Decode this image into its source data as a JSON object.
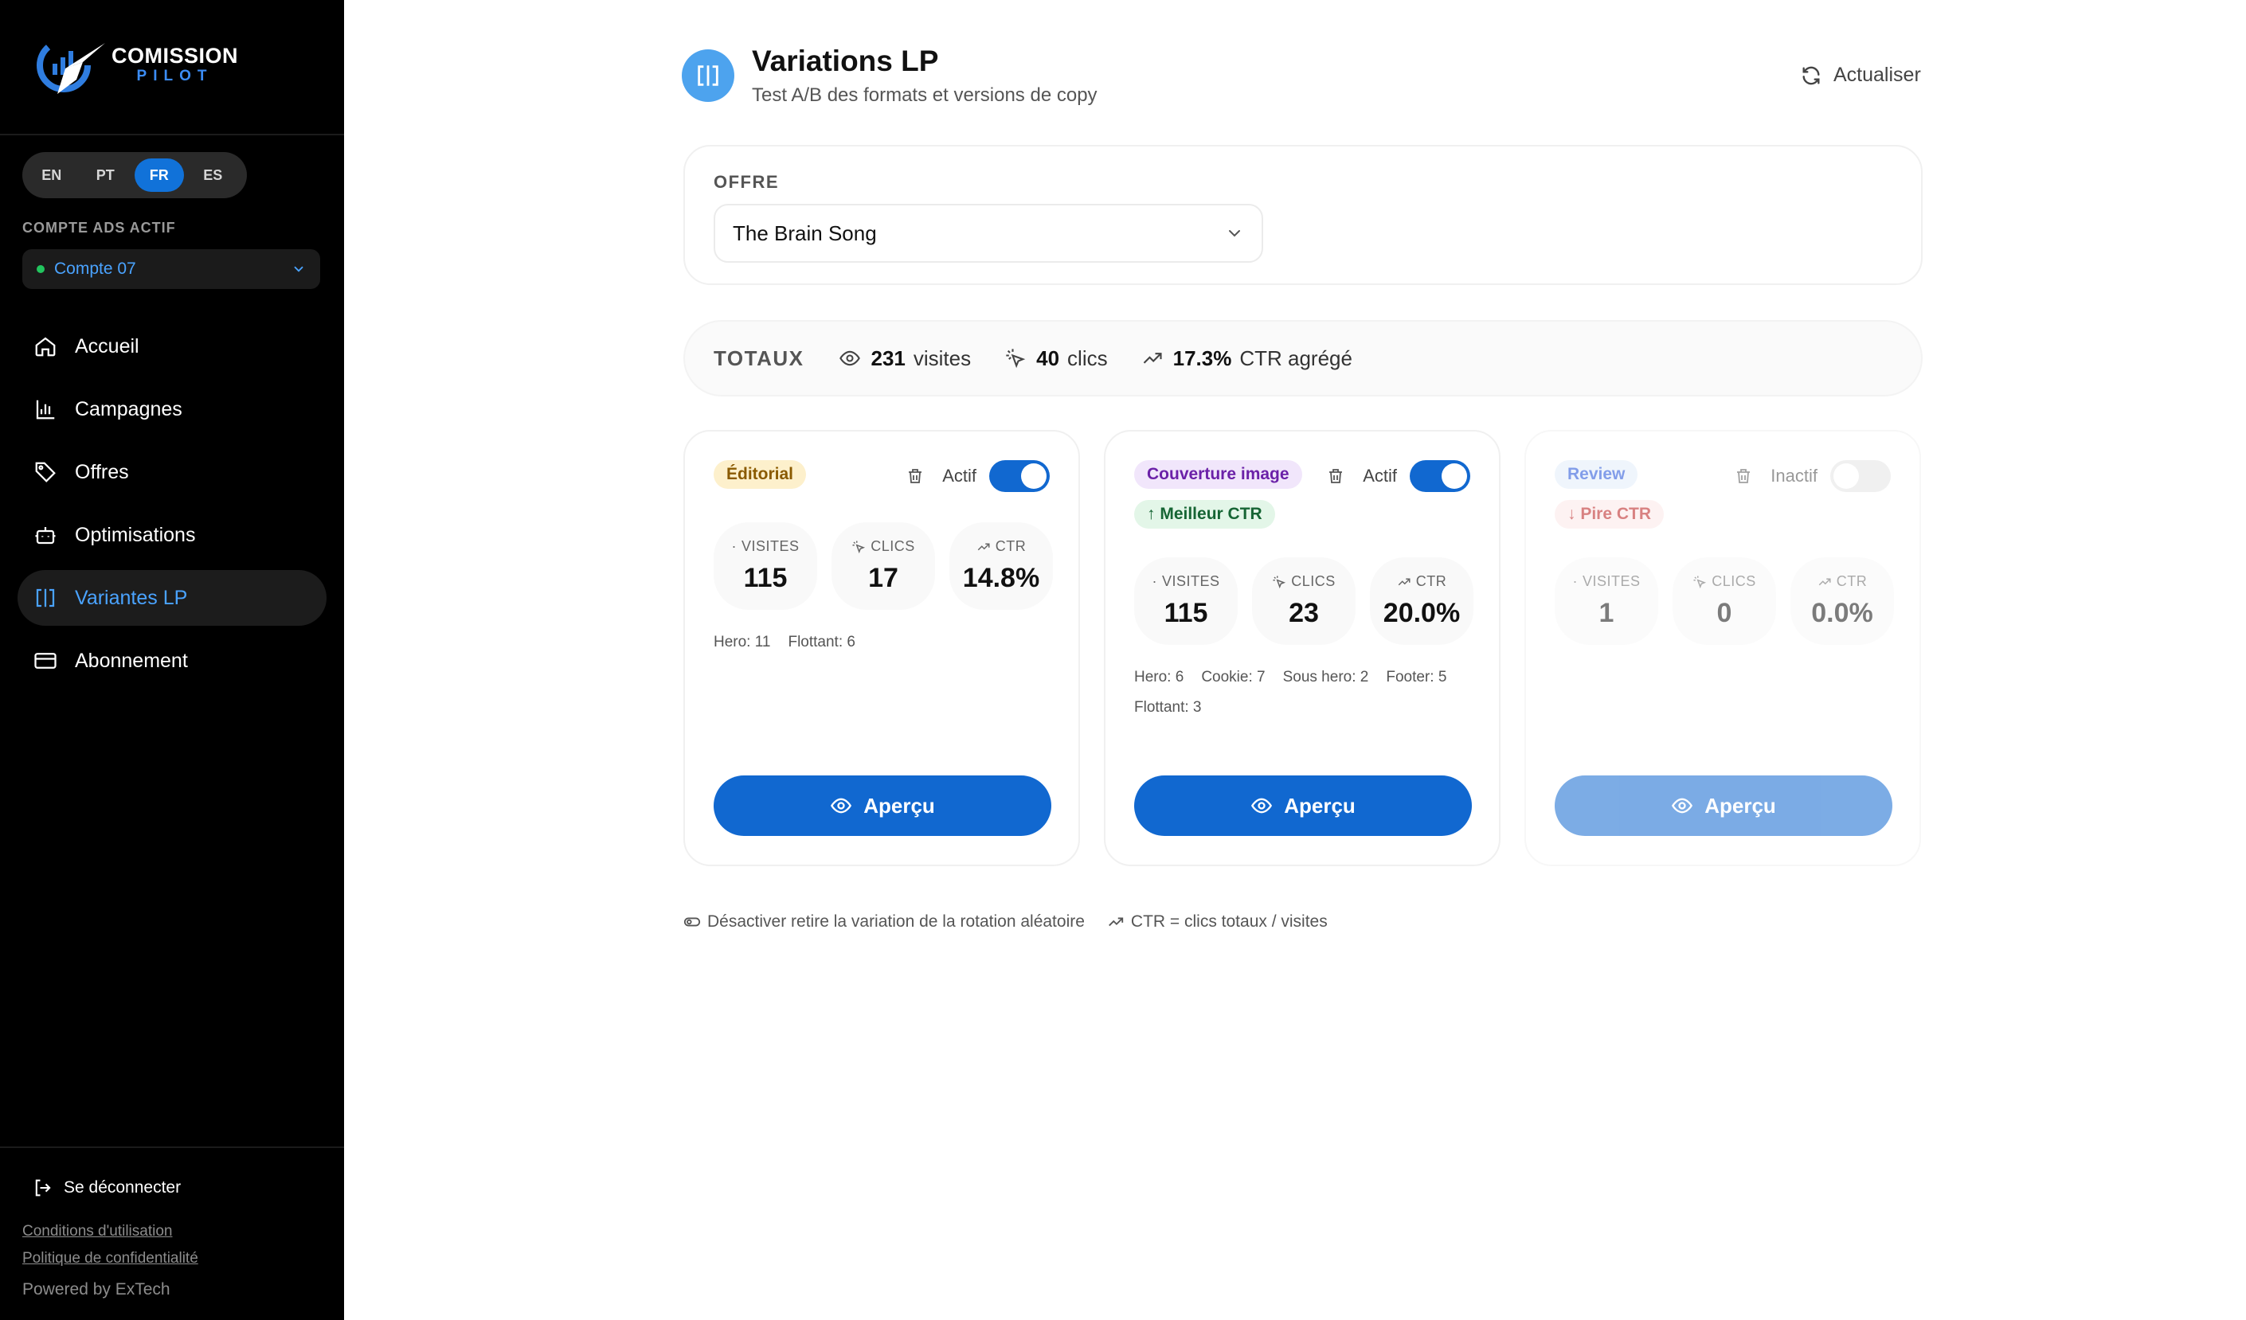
{
  "brand": {
    "line1": "COMISSION",
    "line2": "PILOT",
    "accent": "#3b8cf5"
  },
  "languages": [
    {
      "code": "EN",
      "active": false
    },
    {
      "code": "PT",
      "active": false
    },
    {
      "code": "FR",
      "active": true
    },
    {
      "code": "ES",
      "active": false
    }
  ],
  "account": {
    "section_label": "COMPTE ADS ACTIF",
    "name": "Compte 07",
    "status_color": "#22c55e"
  },
  "nav": [
    {
      "label": "Accueil",
      "icon": "home-icon"
    },
    {
      "label": "Campagnes",
      "icon": "bar-chart-icon"
    },
    {
      "label": "Offres",
      "icon": "tag-icon"
    },
    {
      "label": "Optimisations",
      "icon": "robot-icon"
    },
    {
      "label": "Variantes LP",
      "icon": "split-icon",
      "active": true
    },
    {
      "label": "Abonnement",
      "icon": "credit-card-icon"
    }
  ],
  "sidebar_footer": {
    "logout": "Se déconnecter",
    "terms": "Conditions d'utilisation",
    "privacy": "Politique de confidentialité",
    "powered": "Powered by ExTech"
  },
  "header": {
    "title": "Variations LP",
    "subtitle": "Test A/B des formats et versions de copy",
    "refresh": "Actualiser"
  },
  "offer": {
    "label": "OFFRE",
    "selected": "The Brain Song"
  },
  "totals": {
    "label": "TOTAUX",
    "visits": "231",
    "visits_label": "visites",
    "clicks": "40",
    "clicks_label": "clics",
    "ctr": "17.3%",
    "ctr_label": "CTR agrégé"
  },
  "stat_labels": {
    "visits": "VISITES",
    "clicks": "CLICS",
    "ctr": "CTR"
  },
  "variants": [
    {
      "name": "Éditorial",
      "badge_bg": "#fdf0cc",
      "badge_color": "#8a5a00",
      "status": "Actif",
      "active": true,
      "tag": null,
      "visits": "115",
      "clicks": "17",
      "ctr": "14.8%",
      "breakdown": [
        "Hero: 11",
        "Flottant: 6"
      ],
      "preview": "Aperçu"
    },
    {
      "name": "Couverture image",
      "badge_bg": "#f1e6fb",
      "badge_color": "#6b21a8",
      "status": "Actif",
      "active": true,
      "tag": {
        "text": "↑ Meilleur CTR",
        "bg": "#e3f6e8",
        "color": "#166534"
      },
      "visits": "115",
      "clicks": "23",
      "ctr": "20.0%",
      "breakdown": [
        "Hero: 6",
        "Cookie: 7",
        "Sous hero: 2",
        "Footer: 5",
        "Flottant: 3"
      ],
      "preview": "Aperçu"
    },
    {
      "name": "Review",
      "badge_bg": "#e2edfb",
      "badge_color": "#1d4ed8",
      "status": "Inactif",
      "active": false,
      "tag": {
        "text": "↓ Pire CTR",
        "bg": "#fde8e8",
        "color": "#b91c1c"
      },
      "visits": "1",
      "clicks": "0",
      "ctr": "0.0%",
      "breakdown": [],
      "preview": "Aperçu"
    }
  ],
  "footnotes": {
    "deactivate": "Désactiver retire la variation de la rotation aléatoire",
    "ctr": "CTR = clics totaux / visites"
  },
  "colors": {
    "primary": "#1168d0",
    "sidebar_bg": "#000000",
    "active_link": "#4aa3ff"
  }
}
